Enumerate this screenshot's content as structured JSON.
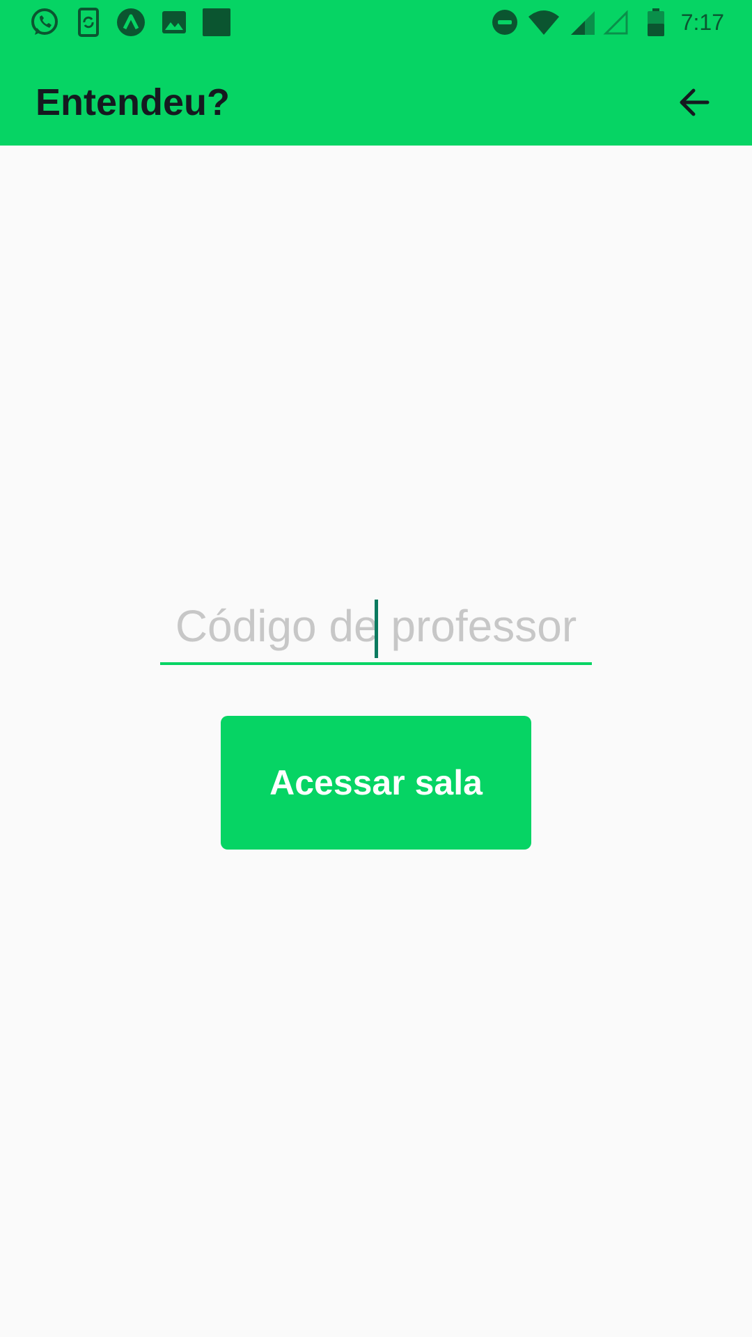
{
  "status_bar": {
    "time": "7:17",
    "left_icons": [
      "whatsapp-icon",
      "phone-sync-icon",
      "arrow-up-circle-icon",
      "image-icon",
      "square-icon"
    ],
    "right_icons": [
      "do-not-disturb-icon",
      "wifi-icon",
      "signal-icon",
      "signal-empty-icon",
      "battery-icon"
    ],
    "background": "#06d464",
    "icon_color": "#0b5530"
  },
  "app_bar": {
    "title": "Entendeu?",
    "back_icon": "arrow-back-icon",
    "background": "#06d464",
    "title_color": "#15191f"
  },
  "form": {
    "teacher_code": {
      "placeholder": "Código de professor",
      "value": ""
    },
    "submit_label": "Acessar sala",
    "accent": "#06d464",
    "caret_color": "#0b7a5f"
  }
}
